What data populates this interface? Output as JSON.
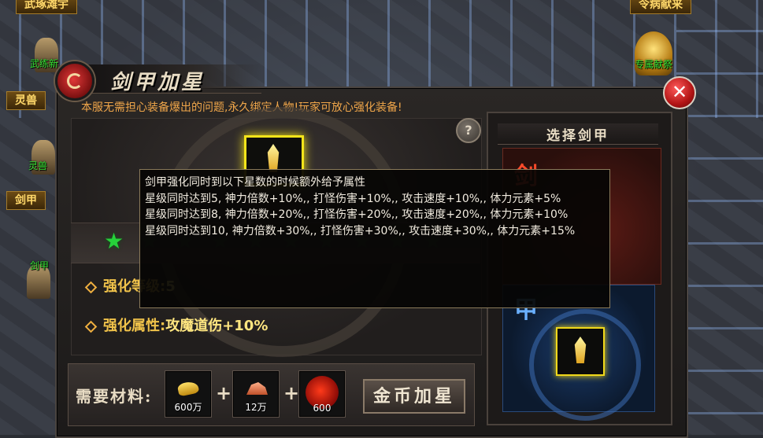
{
  "map": {
    "labels_top": [
      "武琢滩宇",
      "令病献来"
    ],
    "labels_left": [
      "灵兽",
      "剑甲"
    ],
    "npcs": [
      {
        "name": "武练新",
        "icon": "warrior-npc-icon"
      },
      {
        "name": "灵兽",
        "icon": "beast-npc-icon"
      },
      {
        "name": "剑甲",
        "icon": "armor-npc-icon"
      },
      {
        "name": "专属献祭",
        "icon": "altar-npc-icon"
      }
    ]
  },
  "window": {
    "title": "剑甲加星",
    "close_icon": "close-icon",
    "notice": "本服无需担心装备爆出的问题,永久绑定人物!玩家可放心强化装备!",
    "help_label": "?"
  },
  "enhance": {
    "stars_total": 10,
    "stars_lit": 1,
    "level_label": "强化等级:",
    "level_value": "5",
    "attr_label": "强化属性:",
    "attr_value": "攻魔道伤+10%"
  },
  "materials": {
    "label": "需要材料:",
    "items": [
      {
        "icon": "gold-ingot-icon",
        "qty": "600万"
      },
      {
        "icon": "ore-icon",
        "qty": "12万"
      },
      {
        "icon": "red-orb-icon",
        "qty": "600"
      }
    ],
    "plus": "+",
    "button_label": "金币加星"
  },
  "select_panel": {
    "title": "选择剑甲",
    "card_a_char": "剑",
    "card_b_char": "甲"
  },
  "tooltip": {
    "lines": [
      "剑甲强化同时到以下星数的时候额外给予属性",
      "星级同时达到5, 神力倍数+10%,, 打怪伤害+10%,, 攻击速度+10%,, 体力元素+5%",
      "星级同时达到8, 神力倍数+20%,, 打怪伤害+20%,, 攻击速度+20%,, 体力元素+10%",
      "星级同时达到10, 神力倍数+30%,, 打怪伤害+30%,, 攻击速度+30%,, 体力元素+15%"
    ]
  },
  "colors": {
    "notice": "#f0a64a",
    "star_on": "#26d13a",
    "star_off": "#2a4a2e",
    "attr_value": "#ffe680",
    "npc_name": "#34e234"
  }
}
